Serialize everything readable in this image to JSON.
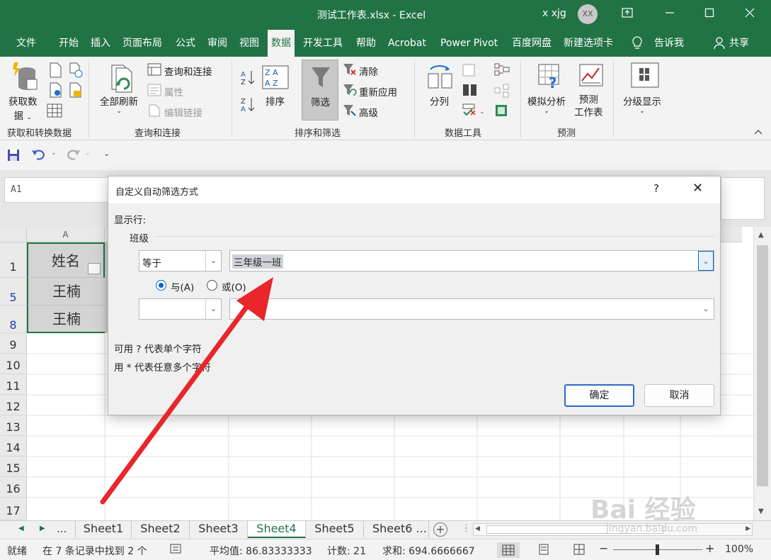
{
  "window": {
    "title": "测试工作表.xlsx  -  Excel",
    "user": "x xjg",
    "avatar": "XX",
    "restore_icon": "ribbon-display-icon",
    "controls": [
      "—",
      "☐",
      "✕"
    ]
  },
  "tabs": [
    "文件",
    "开始",
    "插入",
    "页面布局",
    "公式",
    "审阅",
    "视图",
    "数据",
    "开发工具",
    "帮助",
    "Acrobat",
    "Power Pivot",
    "百度网盘",
    "新建选项卡",
    "告诉我",
    "共享"
  ],
  "active_tab": "数据",
  "ribbon": {
    "get_data": "获取数\n据",
    "get_data_l1": "获取数",
    "get_data_l2": "据",
    "group1_label": "获取和转换数据",
    "refresh_all": "全部刷新",
    "queries_connections": "查询和连接",
    "properties": "属性",
    "edit_links": "编辑链接",
    "group2_label": "查询和连接",
    "sort": "排序",
    "filter": "筛选",
    "clear": "清除",
    "reapply": "重新应用",
    "advanced": "高级",
    "group3_label": "排序和筛选",
    "text_to_columns": "分列",
    "group4_label": "数据工具",
    "what_if": "模拟分析",
    "forecast_l1": "预测",
    "forecast_l2": "工作表",
    "group5_label": "预测",
    "outline": "分级显示"
  },
  "namebox": "A1",
  "grid": {
    "column_a": "A",
    "rows": [
      {
        "num": "1",
        "value": "姓名"
      },
      {
        "num": "5",
        "value": "王楠"
      },
      {
        "num": "8",
        "value": "王楠"
      },
      {
        "num": "9",
        "value": ""
      },
      {
        "num": "10",
        "value": ""
      },
      {
        "num": "11",
        "value": ""
      },
      {
        "num": "12",
        "value": ""
      },
      {
        "num": "13",
        "value": ""
      },
      {
        "num": "14",
        "value": ""
      },
      {
        "num": "15",
        "value": ""
      },
      {
        "num": "16",
        "value": ""
      },
      {
        "num": "17",
        "value": ""
      }
    ]
  },
  "sheets": [
    "Sheet1",
    "Sheet2",
    "Sheet3",
    "Sheet4",
    "Sheet5",
    "Sheet6 ..."
  ],
  "active_sheet": "Sheet4",
  "sheet_nav_more": "...",
  "status": {
    "ready": "就绪",
    "found": "在 7 条记录中找到 2 个",
    "average": "平均值: 86.83333333",
    "count": "计数: 21",
    "sum": "求和: 694.6666667",
    "zoom": "100%"
  },
  "dialog": {
    "title": "自定义自动筛选方式",
    "help": "?",
    "close": "✕",
    "show_rows": "显示行:",
    "field": "班级",
    "op1": "等于",
    "value1": "三年级一班",
    "and_label": "与(A)",
    "or_label": "或(O)",
    "op2": "",
    "value2": "",
    "hint1": "可用 ? 代表单个字符",
    "hint2": "用 * 代表任意多个字符",
    "ok": "确定",
    "cancel": "取消"
  },
  "watermark": "Bai 经验",
  "watermark_url": "jingyan.baidu.com",
  "colors": {
    "excel_green": "#217346",
    "arrow_red": "#e8262b",
    "accent_blue": "#0067c0"
  }
}
